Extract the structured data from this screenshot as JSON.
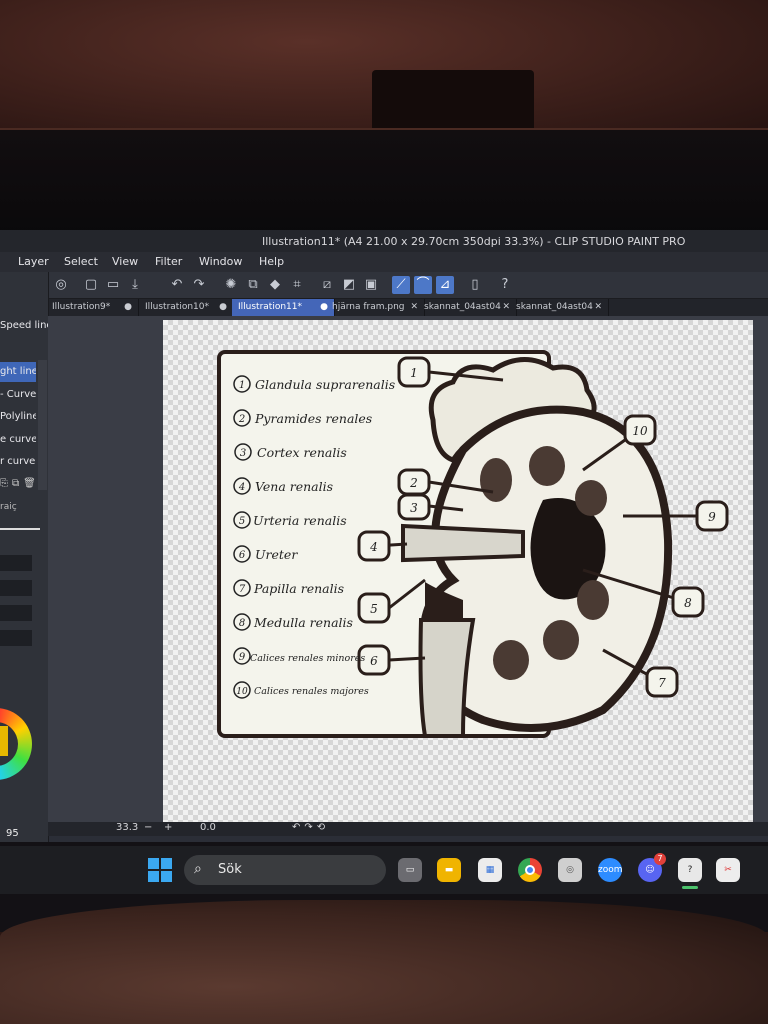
{
  "window": {
    "title": "Illustration11* (A4 21.00 x 29.70cm 350dpi 33.3%) - CLIP STUDIO PAINT PRO"
  },
  "menu": [
    "Layer",
    "Select",
    "View",
    "Filter",
    "Window",
    "Help"
  ],
  "toolbar_icons": [
    "app-logo-icon",
    "new-file-icon",
    "open-file-icon",
    "save-icon",
    "undo-icon",
    "redo-icon",
    "clear-icon",
    "transform-icon",
    "fill-icon",
    "crop-icon",
    "snap-ruler-icon",
    "snap-special-icon",
    "grid-icon",
    "snap-line-icon",
    "snap-curve-icon",
    "snap-polyline-icon",
    "device-icon",
    "help-icon"
  ],
  "tabs": [
    {
      "label": "Illustration9*",
      "marker": "●"
    },
    {
      "label": "Illustration10*",
      "marker": "●"
    },
    {
      "label": "Illustration11*",
      "marker": "●"
    },
    {
      "label": "hjärna fram.png",
      "marker": "✕"
    },
    {
      "label": "skannat_04ast04",
      "marker": "✕"
    },
    {
      "label": "skannat_04ast04",
      "marker": "✕"
    }
  ],
  "left_panel": {
    "header": "Speed line",
    "items": [
      "ght line",
      "- Curve",
      "Polyline",
      "e curve",
      "r curve"
    ],
    "tool_label": "raiç",
    "color_value": "95"
  },
  "diagram": {
    "legend": [
      {
        "num": "1",
        "text": "Glandula suprarenalis"
      },
      {
        "num": "2",
        "text": "Pyramides renales"
      },
      {
        "num": "3",
        "text": "Cortex renalis"
      },
      {
        "num": "4",
        "text": "Vena renalis"
      },
      {
        "num": "5",
        "text": "Urteria renalis"
      },
      {
        "num": "6",
        "text": "Ureter"
      },
      {
        "num": "7",
        "text": "Papilla renalis"
      },
      {
        "num": "8",
        "text": "Medulla renalis"
      },
      {
        "num": "9",
        "text": "Calices renales minores"
      },
      {
        "num": "10",
        "text": "Calices renales majores"
      }
    ]
  },
  "status": {
    "zoom": "33.3",
    "minus": "−",
    "plus": "+",
    "rotation": "0.0"
  },
  "taskbar": {
    "search_label": "Sök",
    "apps": [
      "task-view-icon",
      "file-explorer-icon",
      "store-icon",
      "chrome-icon",
      "clip-studio-icon",
      "zoom-icon",
      "discord-icon",
      "clip-studio-paint-icon",
      "snipping-tool-icon"
    ],
    "discord_badge": "7",
    "zoom_label": "zoom"
  },
  "colors": {
    "accent": "#4466b8",
    "ink": "#2a1e1a"
  }
}
